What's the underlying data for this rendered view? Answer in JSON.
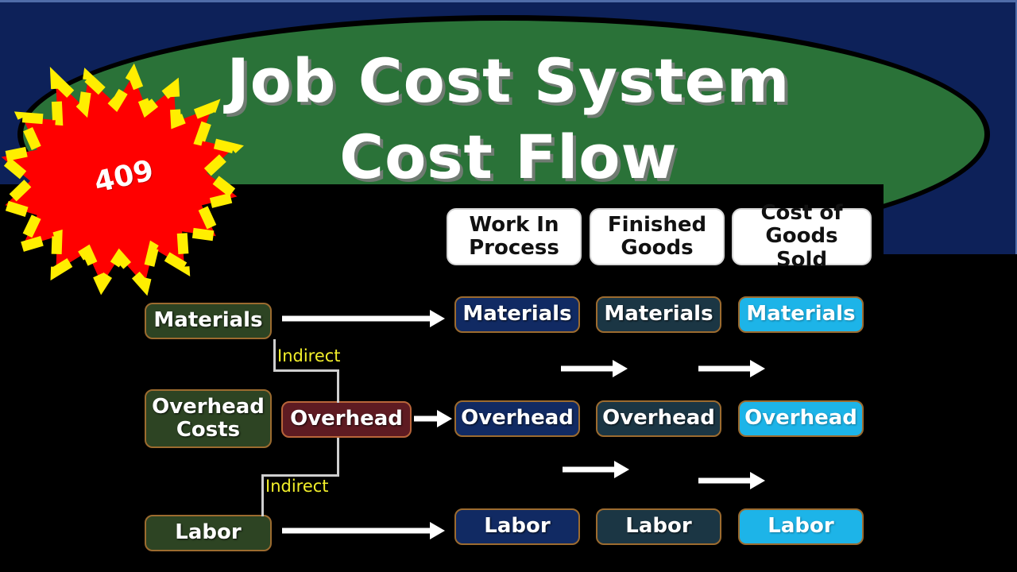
{
  "slide": {
    "title_line1": "Job Cost System",
    "title_line2": "Cost Flow",
    "badge_number": "409",
    "colors": {
      "header_background": "#0d2159",
      "header_ellipse": "#2a7238",
      "content_background": "#000000",
      "source_box": "#2d4423",
      "overhead_box": "#5e1b22",
      "work_in_process_box": "#112a63",
      "finished_goods_box": "#1b3644",
      "cost_of_goods_sold_box": "#1db4e8",
      "box_border": "#9c6b2f",
      "indirect_label": "#f2ef2a",
      "arrow": "#ffffff",
      "connector": "#cfcfcf",
      "badge_fill": "#ff0000",
      "badge_outline": "#ffee00"
    }
  },
  "columns": [
    {
      "id": "work-in-process",
      "label": "Work In\nProcess",
      "line1": "Work In",
      "line2": "Process"
    },
    {
      "id": "finished-goods",
      "label": "Finished\nGoods",
      "line1": "Finished",
      "line2": "Goods"
    },
    {
      "id": "cost-of-goods-sold",
      "label": "Cost of\nGoods Sold",
      "line1": "Cost of",
      "line2": "Goods Sold"
    }
  ],
  "sources": [
    {
      "id": "materials",
      "label": "Materials",
      "line1": "Materials",
      "line2": ""
    },
    {
      "id": "overhead-costs",
      "label": "Overhead Costs",
      "line1": "Overhead",
      "line2": "Costs"
    },
    {
      "id": "labor",
      "label": "Labor",
      "line1": "Labor",
      "line2": ""
    }
  ],
  "overhead_pool": {
    "label": "Overhead"
  },
  "rows": [
    {
      "id": "materials",
      "work_in_process": "Materials",
      "finished_goods": "Materials",
      "cost_of_goods_sold": "Materials"
    },
    {
      "id": "overhead",
      "work_in_process": "Overhead",
      "finished_goods": "Overhead",
      "cost_of_goods_sold": "Overhead"
    },
    {
      "id": "labor",
      "work_in_process": "Labor",
      "finished_goods": "Labor",
      "cost_of_goods_sold": "Labor"
    }
  ],
  "connectors": [
    {
      "id": "materials-to-overhead",
      "label": "Indirect"
    },
    {
      "id": "overhead-to-labor",
      "label": "Indirect"
    }
  ]
}
